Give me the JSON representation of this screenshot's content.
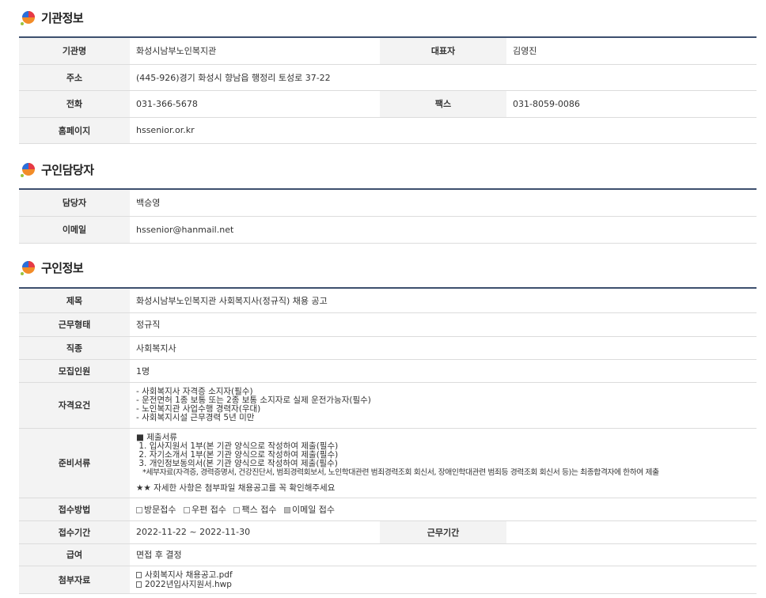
{
  "sections": {
    "agency": {
      "title": "기관정보"
    },
    "contact": {
      "title": "구인담당자"
    },
    "job": {
      "title": "구인정보"
    }
  },
  "agency": {
    "name_label": "기관명",
    "name": "화성시남부노인복지관",
    "rep_label": "대표자",
    "rep": "김영진",
    "addr_label": "주소",
    "addr": "(445-926)경기 화성시 향남읍 행정리 토성로 37-22",
    "phone_label": "전화",
    "phone": "031-366-5678",
    "fax_label": "팩스",
    "fax": "031-8059-0086",
    "home_label": "홈페이지",
    "home": "hssenior.or.kr"
  },
  "contact": {
    "person_label": "담당자",
    "person": "백승영",
    "email_label": "이메일",
    "email": "hssenior@hanmail.net"
  },
  "job": {
    "title_label": "제목",
    "title": "화성시남부노인복지관 사회복지사(정규직) 채용 공고",
    "type_label": "근무형태",
    "type": "정규직",
    "occ_label": "직종",
    "occ": "사회복지사",
    "count_label": "모집인원",
    "count": "1명",
    "qual_label": "자격요건",
    "qual": [
      "- 사회복지사 자격증 소지자(필수)",
      "- 운전면허 1종 보통 또는 2종 보통 소지자로 실제 운전가능자(필수)",
      "- 노인복지관 사업수행 경력자(우대)",
      "- 사회복지시설 근무경력 5년 미만"
    ],
    "docs_label": "준비서류",
    "docs": [
      "■ 제출서류",
      " 1. 입사지원서 1부(본 기관 양식으로 작성하여 제출(필수)",
      " 2. 자기소개서 1부(본 기관 양식으로 작성하여 제출(필수)",
      " 3. 개인정보동의서(본 기관 양식으로 작성하여 제출(필수)",
      "   *세부자료(자격증, 경력증명서, 건강진단서, 범죄경력회보서, 노인학대관련 범죄경력조회 회신서, 장애인학대관련 범죄등 경력조회 회신서 등)는 최종합격자에 한하여 제출"
    ],
    "docs_note": "★★ 자세한 사항은 첨부파일 채용공고를 꼭 확인해주세요",
    "method_label": "접수방법",
    "methods": [
      {
        "label": "방문접수",
        "checked": false
      },
      {
        "label": "우편 접수",
        "checked": false
      },
      {
        "label": "팩스 접수",
        "checked": false
      },
      {
        "label": "이메일 접수",
        "checked": true
      }
    ],
    "period_label": "접수기간",
    "period": "2022-11-22 ~ 2022-11-30",
    "work_period_label": "근무기간",
    "work_period": "",
    "salary_label": "급여",
    "salary": "면접 후 결정",
    "files_label": "첨부자료",
    "files": [
      "사회복지사 채용공고.pdf",
      "2022년입사지원서.hwp"
    ]
  }
}
